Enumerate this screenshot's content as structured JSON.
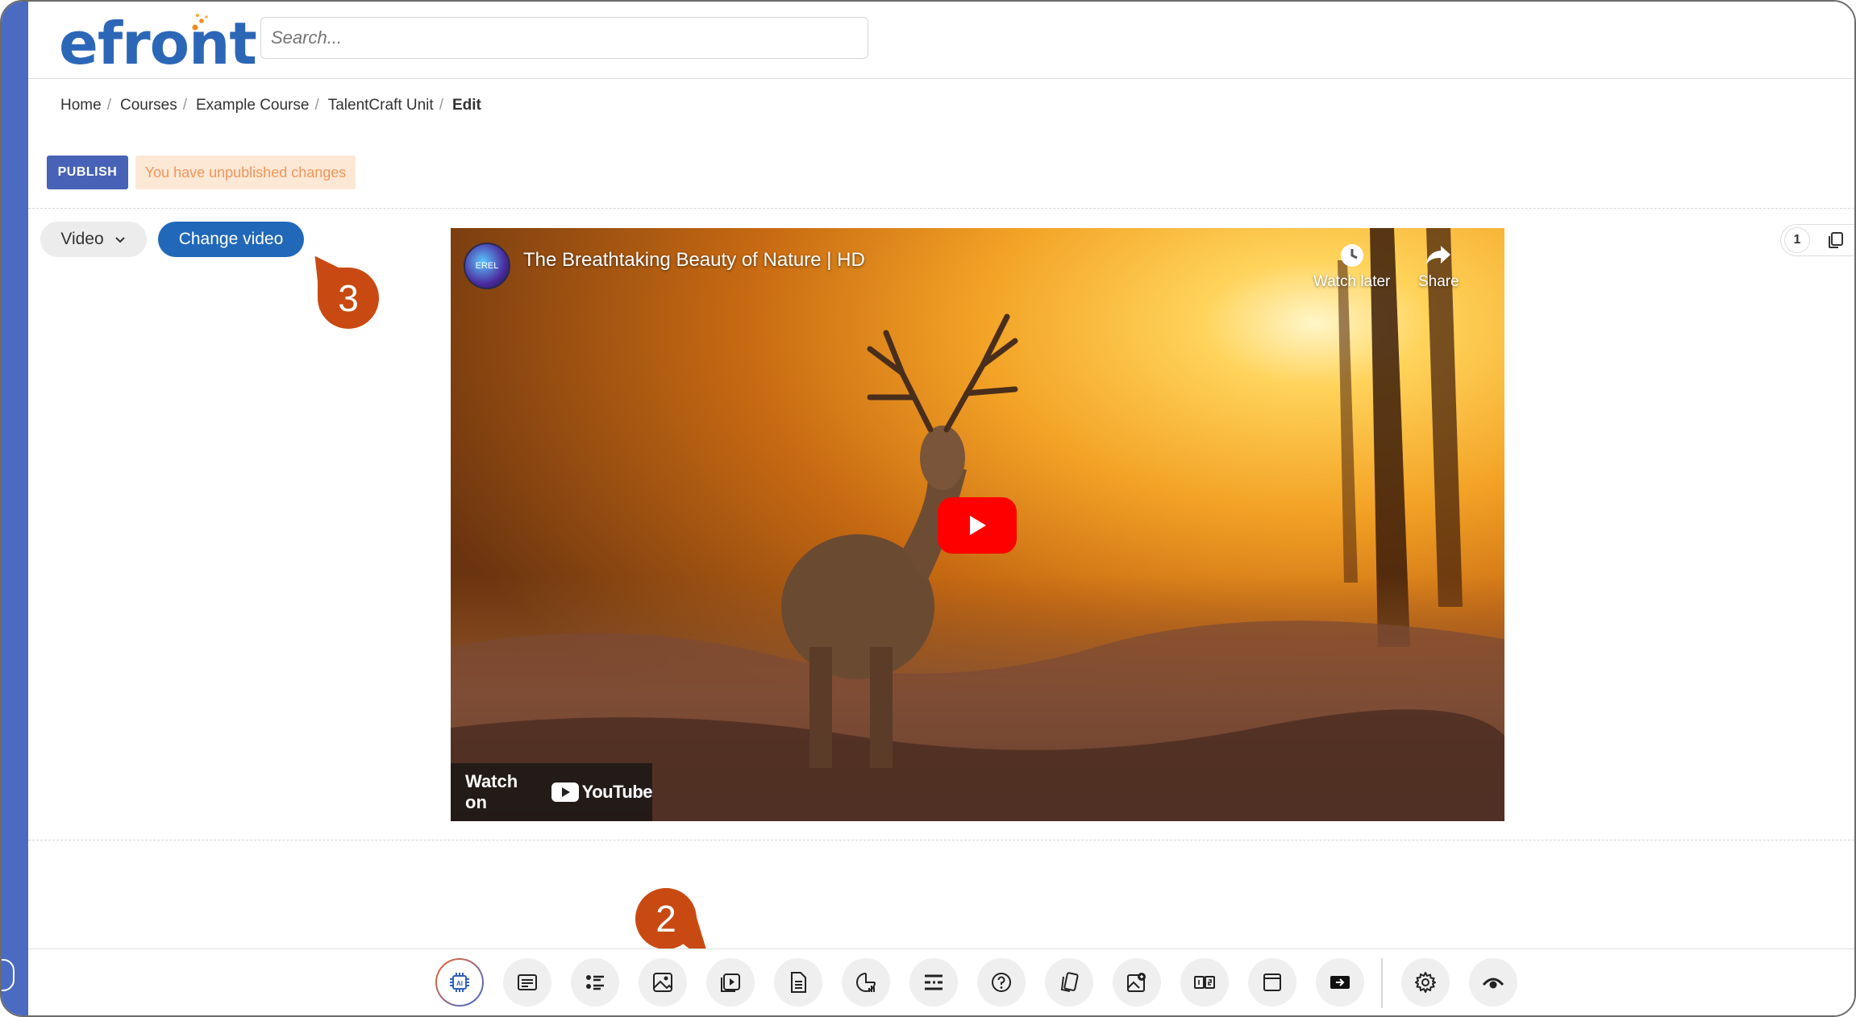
{
  "app": {
    "logo_text": "efront",
    "search_placeholder": "Search..."
  },
  "breadcrumb": {
    "items": [
      "Home",
      "Courses",
      "Example Course",
      "TalentCraft Unit"
    ],
    "separator": "/",
    "current": "Edit"
  },
  "publish": {
    "button_label": "PUBLISH",
    "status_text": "You have unpublished changes"
  },
  "editor": {
    "block_type": "Video",
    "change_video_label": "Change video"
  },
  "video": {
    "title": "The Breathtaking Beauty of Nature | HD",
    "channel_avatar_text": "EREL",
    "watch_later_label": "Watch later",
    "share_label": "Share",
    "watch_on_label": "Watch on",
    "youtube_label": "YouTube"
  },
  "page_controls": {
    "page_number": "1"
  },
  "annotations": {
    "badge_change_video": "3",
    "badge_toolbar": "2"
  },
  "toolbar": {
    "icons": [
      "ai-icon",
      "text-icon",
      "list-icon",
      "image-icon",
      "video-icon",
      "document-icon",
      "chart-icon",
      "divider-icon",
      "question-icon",
      "flashcards-icon",
      "image-hotspot-icon",
      "comparison-icon",
      "embed-icon",
      "presentation-icon",
      "settings-icon",
      "preview-icon"
    ]
  },
  "colors": {
    "brand_blue": "#2c67b7",
    "brand_orange": "#f08c1c",
    "publish_blue": "#4762b7",
    "change_video_blue": "#2168b9",
    "annotation_orange": "#c84a12",
    "rail_blue": "#4b6ac1"
  }
}
